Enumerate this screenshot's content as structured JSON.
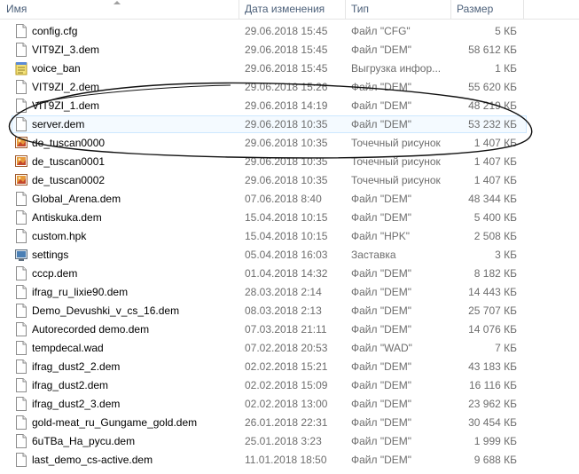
{
  "columns": {
    "name": "Имя",
    "date": "Дата изменения",
    "type": "Тип",
    "size": "Размер"
  },
  "files": [
    {
      "name": "config.cfg",
      "date": "29.06.2018 15:45",
      "type": "Файл \"CFG\"",
      "size": "5 КБ",
      "icon": "document-icon"
    },
    {
      "name": "VIT9ZI_3.dem",
      "date": "29.06.2018 15:45",
      "type": "Файл \"DEM\"",
      "size": "58 612 КБ",
      "icon": "document-icon"
    },
    {
      "name": "voice_ban",
      "date": "29.06.2018 15:45",
      "type": "Выгрузка инфор...",
      "size": "1 КБ",
      "icon": "notepad-icon"
    },
    {
      "name": "VIT9ZI_2.dem",
      "date": "29.06.2018 15:26",
      "type": "Файл \"DEM\"",
      "size": "55 620 КБ",
      "icon": "document-icon"
    },
    {
      "name": "VIT9ZI_1.dem",
      "date": "29.06.2018 14:19",
      "type": "Файл \"DEM\"",
      "size": "48 219 КБ",
      "icon": "document-icon"
    },
    {
      "name": "server.dem",
      "date": "29.06.2018 10:35",
      "type": "Файл \"DEM\"",
      "size": "53 232 КБ",
      "icon": "document-icon"
    },
    {
      "name": "de_tuscan0000",
      "date": "29.06.2018 10:35",
      "type": "Точечный рисунок",
      "size": "1 407 КБ",
      "icon": "bitmap-icon"
    },
    {
      "name": "de_tuscan0001",
      "date": "29.06.2018 10:35",
      "type": "Точечный рисунок",
      "size": "1 407 КБ",
      "icon": "bitmap-icon"
    },
    {
      "name": "de_tuscan0002",
      "date": "29.06.2018 10:35",
      "type": "Точечный рисунок",
      "size": "1 407 КБ",
      "icon": "bitmap-icon"
    },
    {
      "name": "Global_Arena.dem",
      "date": "07.06.2018 8:40",
      "type": "Файл \"DEM\"",
      "size": "48 344 КБ",
      "icon": "document-icon"
    },
    {
      "name": "Antiskuka.dem",
      "date": "15.04.2018 10:15",
      "type": "Файл \"DEM\"",
      "size": "5 400 КБ",
      "icon": "document-icon"
    },
    {
      "name": "custom.hpk",
      "date": "15.04.2018 10:15",
      "type": "Файл \"HPK\"",
      "size": "2 508 КБ",
      "icon": "document-icon"
    },
    {
      "name": "settings",
      "date": "05.04.2018 16:03",
      "type": "Заставка",
      "size": "3 КБ",
      "icon": "screensaver-icon"
    },
    {
      "name": "cccp.dem",
      "date": "01.04.2018 14:32",
      "type": "Файл \"DEM\"",
      "size": "8 182 КБ",
      "icon": "document-icon"
    },
    {
      "name": "ifrag_ru_lixie90.dem",
      "date": "28.03.2018 2:14",
      "type": "Файл \"DEM\"",
      "size": "14 443 КБ",
      "icon": "document-icon"
    },
    {
      "name": "Demo_Devushki_v_cs_16.dem",
      "date": "08.03.2018 2:13",
      "type": "Файл \"DEM\"",
      "size": "25 707 КБ",
      "icon": "document-icon"
    },
    {
      "name": "Autorecorded demo.dem",
      "date": "07.03.2018 21:11",
      "type": "Файл \"DEM\"",
      "size": "14 076 КБ",
      "icon": "document-icon"
    },
    {
      "name": "tempdecal.wad",
      "date": "07.02.2018 20:53",
      "type": "Файл \"WAD\"",
      "size": "7 КБ",
      "icon": "document-icon"
    },
    {
      "name": "ifrag_dust2_2.dem",
      "date": "02.02.2018 15:21",
      "type": "Файл \"DEM\"",
      "size": "43 183 КБ",
      "icon": "document-icon"
    },
    {
      "name": "ifrag_dust2.dem",
      "date": "02.02.2018 15:09",
      "type": "Файл \"DEM\"",
      "size": "16 116 КБ",
      "icon": "document-icon"
    },
    {
      "name": "ifrag_dust2_3.dem",
      "date": "02.02.2018 13:00",
      "type": "Файл \"DEM\"",
      "size": "23 962 КБ",
      "icon": "document-icon"
    },
    {
      "name": "gold-meat_ru_Gungame_gold.dem",
      "date": "26.01.2018 22:31",
      "type": "Файл \"DEM\"",
      "size": "30 454 КБ",
      "icon": "document-icon"
    },
    {
      "name": "6uTBa_Ha_pycu.dem",
      "date": "25.01.2018 3:23",
      "type": "Файл \"DEM\"",
      "size": "1 999 КБ",
      "icon": "document-icon"
    },
    {
      "name": "last_demo_cs-active.dem",
      "date": "11.01.2018 18:50",
      "type": "Файл \"DEM\"",
      "size": "9 688 КБ",
      "icon": "document-icon"
    }
  ],
  "selected_file": "server.dem"
}
